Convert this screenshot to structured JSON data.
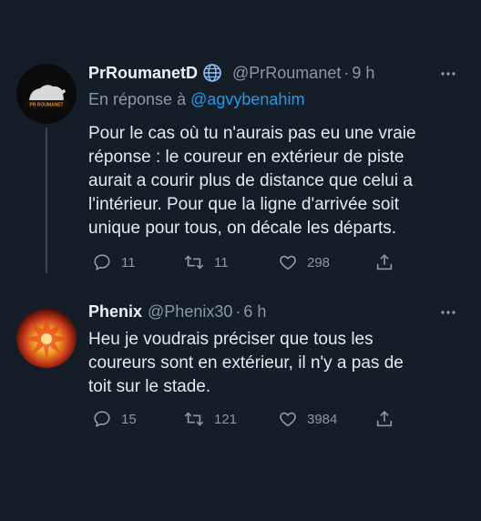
{
  "tweets": [
    {
      "name": "PrRoumanetD",
      "handle": "@PrRoumanet",
      "separator": "·",
      "time": "9 h",
      "reply_prefix": "En réponse à",
      "reply_mention": "@agvybenahim",
      "text": "Pour le cas où tu n'aurais pas eu une vraie\nréponse :  le coureur en extérieur de piste\naurait a courir plus de distance que celui a\nl'intérieur. Pour que la ligne d'arrivée soit\nunique pour tous, on décale les départs.",
      "avatar_label": "PR ROUMANET",
      "stats": {
        "replies": "11",
        "retweets": "11",
        "likes": "298"
      }
    },
    {
      "name": "Phenix",
      "handle": "@Phenix30",
      "separator": "·",
      "time": "6 h",
      "text": "Heu je voudrais préciser que tous les\ncoureurs sont en extérieur, il n'y a pas de\ntoit sur le stade.",
      "stats": {
        "replies": "15",
        "retweets": "121",
        "likes": "3984"
      }
    }
  ],
  "colors": {
    "background": "#151d27",
    "text": "#e7e9ea",
    "muted": "#8b98a5",
    "link": "#1d9bf0"
  },
  "icons": [
    "globe-verified-icon",
    "more-icon",
    "reply-icon",
    "retweet-icon",
    "like-icon",
    "share-icon"
  ]
}
